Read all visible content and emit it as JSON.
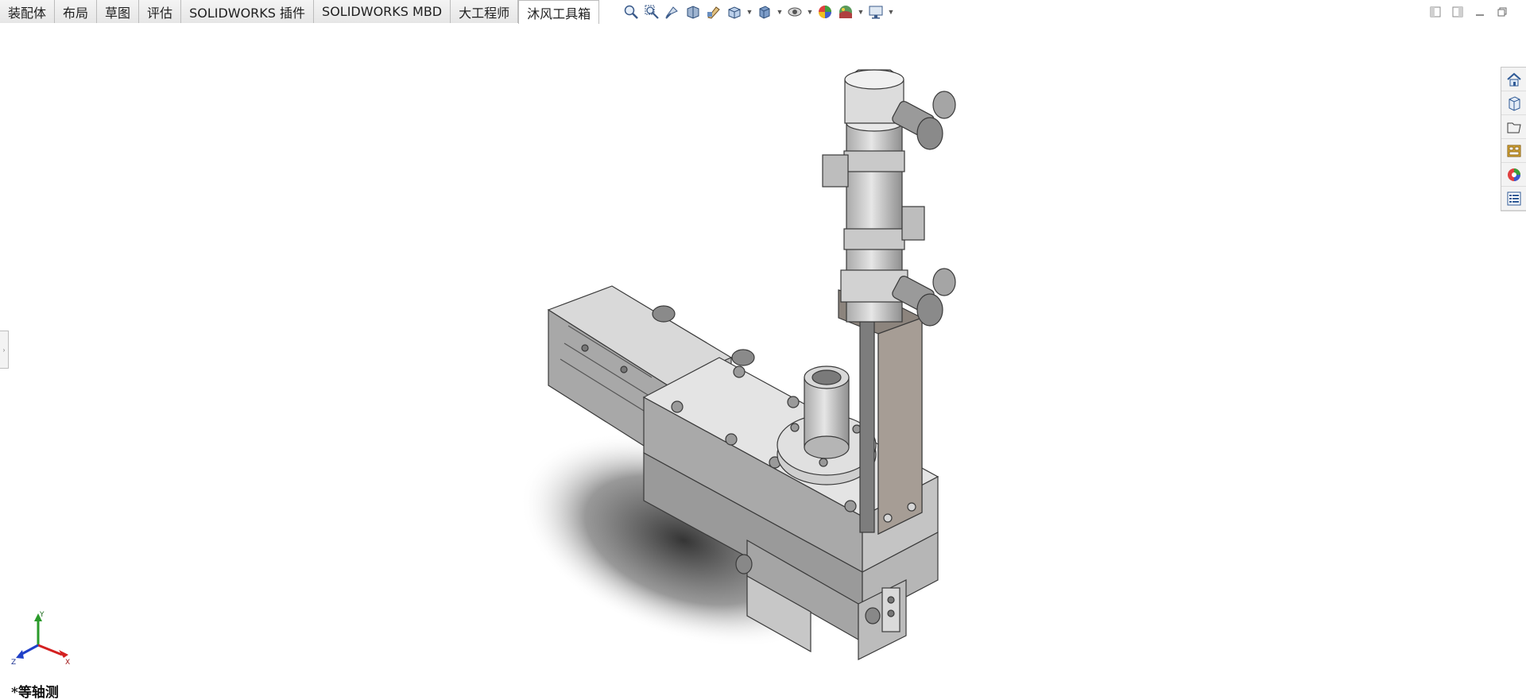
{
  "tabs": [
    {
      "label": "装配体",
      "active": false
    },
    {
      "label": "布局",
      "active": false
    },
    {
      "label": "草图",
      "active": false
    },
    {
      "label": "评估",
      "active": false
    },
    {
      "label": "SOLIDWORKS 插件",
      "active": false
    },
    {
      "label": "SOLIDWORKS MBD",
      "active": false
    },
    {
      "label": "大工程师",
      "active": false
    },
    {
      "label": "沐风工具箱",
      "active": true
    }
  ],
  "hud_icons": [
    "zoom-to-fit-icon",
    "zoom-to-area-icon",
    "previous-view-icon",
    "section-view-icon",
    "dynamic-annotation-icon",
    "view-orientation-icon",
    "display-style-icon",
    "hide-show-items-icon",
    "edit-appearance-icon",
    "apply-scene-icon",
    "view-settings-icon"
  ],
  "window_controls": [
    "tile-left-icon",
    "tile-right-icon",
    "minimize-icon",
    "restore-icon"
  ],
  "task_pane_icons": [
    "solidworks-resources-icon",
    "design-library-icon",
    "file-explorer-icon",
    "view-palette-icon",
    "appearances-scenes-icon",
    "custom-properties-icon"
  ],
  "triad": {
    "x": "X",
    "y": "Y",
    "z": "Z"
  },
  "view_label": "*等轴测",
  "colors": {
    "axis_x": "#d42020",
    "axis_y": "#2a9a2a",
    "axis_z": "#2040c8",
    "model_gray": "#c9c9c9"
  }
}
